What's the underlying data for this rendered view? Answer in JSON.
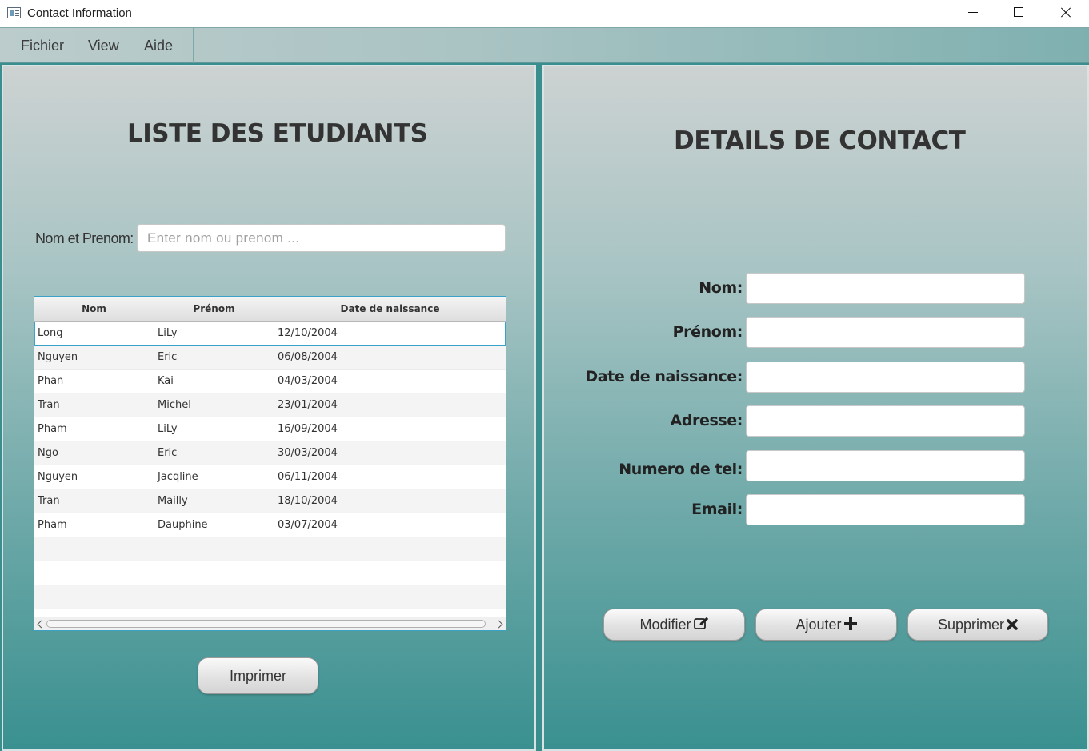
{
  "window": {
    "title": "Contact Information"
  },
  "menu": {
    "items": [
      "Fichier",
      "View",
      "Aide"
    ]
  },
  "left_panel": {
    "heading": "LISTE DES ETUDIANTS",
    "search_label": "Nom et Prenom:",
    "search_placeholder": "Enter nom ou prenom ...",
    "search_value": "",
    "table": {
      "columns": [
        "Nom",
        "Prénom",
        "Date de naissance"
      ],
      "rows": [
        [
          "Long",
          "LiLy",
          "12/10/2004"
        ],
        [
          "Nguyen",
          "Eric",
          "06/08/2004"
        ],
        [
          "Phan",
          "Kai",
          "04/03/2004"
        ],
        [
          "Tran",
          "Michel",
          "23/01/2004"
        ],
        [
          "Pham",
          "LiLy",
          "16/09/2004"
        ],
        [
          "Ngo",
          "Eric",
          "30/03/2004"
        ],
        [
          "Nguyen",
          "Jacqline",
          "06/11/2004"
        ],
        [
          "Tran",
          "Mailly",
          "18/10/2004"
        ],
        [
          "Pham",
          "Dauphine",
          "03/07/2004"
        ]
      ],
      "selected_row": 0
    },
    "print_button": "Imprimer"
  },
  "right_panel": {
    "heading": "DETAILS DE CONTACT",
    "fields": [
      {
        "label": "Nom:",
        "value": ""
      },
      {
        "label": "Prénom:",
        "value": ""
      },
      {
        "label": "Date de naissance:",
        "value": ""
      },
      {
        "label": "Adresse:",
        "value": ""
      },
      {
        "label": "Numero de tel:",
        "value": ""
      },
      {
        "label": "Email:",
        "value": ""
      }
    ],
    "buttons": {
      "modify": {
        "label": "Modifier",
        "icon": "edit-icon"
      },
      "add": {
        "label": "Ajouter",
        "icon": "plus-icon"
      },
      "delete": {
        "label": "Supprimer",
        "icon": "times-icon"
      }
    }
  },
  "colors": {
    "accent": "#3aa2c8",
    "panel_bottom": "#3a9090",
    "panel_top": "#cdd2d2"
  }
}
